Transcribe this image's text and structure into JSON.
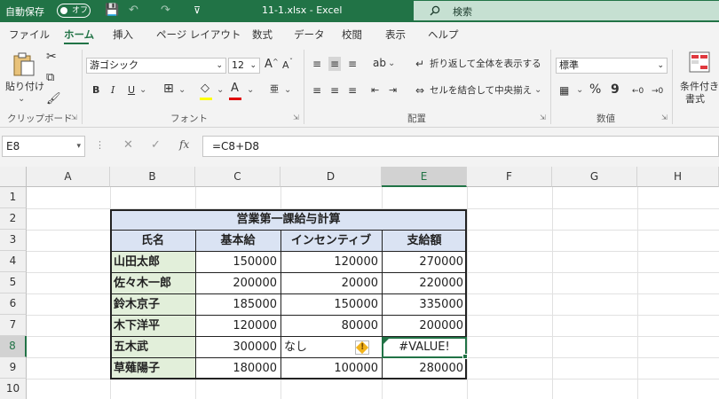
{
  "titlebar": {
    "autosave_label": "自動保存",
    "autosave_state": "オフ",
    "save_icon": "💾",
    "undo_icon": "↶",
    "redo_icon": "↷",
    "customize_icon": "⊽",
    "title": "11-1.xlsx  -  Excel",
    "search_label": "検索"
  },
  "menu": {
    "tabs": [
      "ファイル",
      "ホーム",
      "挿入",
      "ページ レイアウト",
      "数式",
      "データ",
      "校閲",
      "表示",
      "ヘルプ"
    ],
    "active": "ホーム"
  },
  "ribbon": {
    "clipboard": {
      "paste_label": "貼り付け",
      "group_label": "クリップボード"
    },
    "font": {
      "font_name": "游ゴシック",
      "font_size": "12",
      "grow": "A",
      "shrink": "A",
      "bold": "B",
      "italic": "I",
      "underline": "U",
      "fill_letter": "A",
      "font_color_letter": "A",
      "phonetic": "亜",
      "group_label": "フォント"
    },
    "alignment": {
      "wrap_text": "折り返して全体を表示する",
      "merge_center": "セルを結合して中央揃え",
      "group_label": "配置"
    },
    "number": {
      "format": "標準",
      "percent": "%",
      "comma": "9",
      "group_label": "数値"
    },
    "styles": {
      "conditional_line1": "条件付き",
      "conditional_line2": "書式"
    }
  },
  "formula_bar": {
    "name_box": "E8",
    "formula": "=C8+D8",
    "fx": "fx"
  },
  "sheet": {
    "columns": [
      "A",
      "B",
      "C",
      "D",
      "E",
      "F",
      "G",
      "H"
    ],
    "selected_column": "E",
    "rows": [
      "1",
      "2",
      "3",
      "4",
      "5",
      "6",
      "7",
      "8",
      "9",
      "10"
    ],
    "selected_row": "8",
    "table_title": "営業第一課給与計算",
    "headers": [
      "氏名",
      "基本給",
      "インセンティブ",
      "支給額"
    ],
    "data": [
      [
        "山田太郎",
        "150000",
        "120000",
        "270000"
      ],
      [
        "佐々木一郎",
        "200000",
        "20000",
        "220000"
      ],
      [
        "鈴木京子",
        "185000",
        "150000",
        "335000"
      ],
      [
        "木下洋平",
        "120000",
        "80000",
        "200000"
      ],
      [
        "五木武",
        "300000",
        "なし",
        "#VALUE!"
      ],
      [
        "草薙陽子",
        "180000",
        "100000",
        "280000"
      ]
    ],
    "error_icon": "!"
  }
}
